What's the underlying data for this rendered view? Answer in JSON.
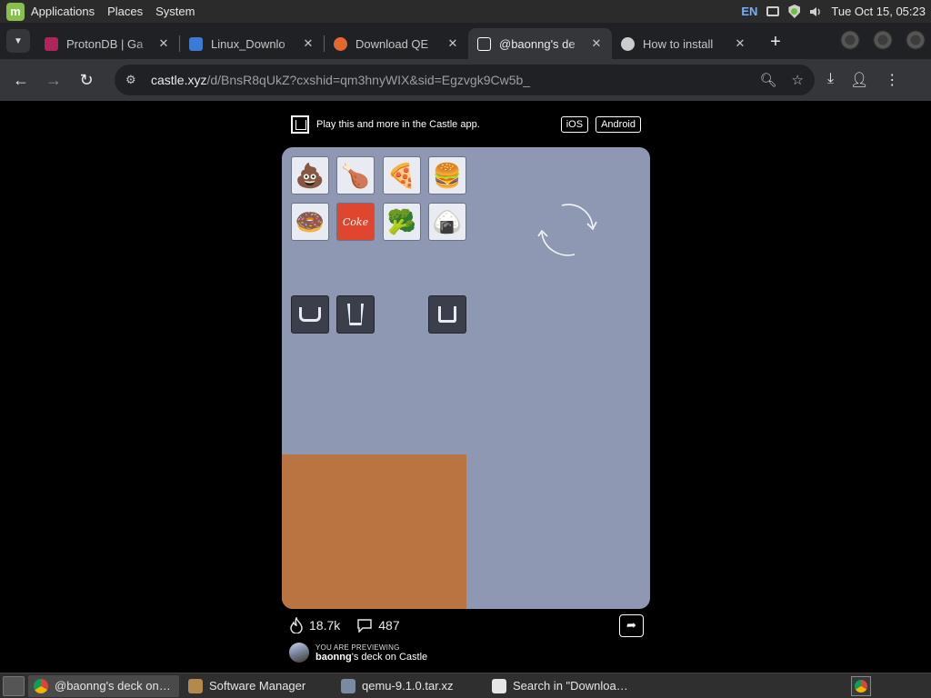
{
  "system_panel": {
    "menu": [
      "Applications",
      "Places",
      "System"
    ],
    "keyboard_layout": "EN",
    "clock": "Tue Oct 15, 05:23"
  },
  "tabs": [
    {
      "title": "ProtonDB | Ga",
      "favicon_color": "#b0245b",
      "active": false
    },
    {
      "title": "Linux_Downlo",
      "favicon_color": "#3a7bd5",
      "active": false
    },
    {
      "title": "Download QE",
      "favicon_color": "#e5672e",
      "active": false
    },
    {
      "title": "@baonng's de",
      "favicon_color": "#ffffff",
      "active": true
    },
    {
      "title": "How to install",
      "favicon_color": "#cccccc",
      "active": false
    }
  ],
  "address_bar": {
    "domain": "castle.xyz",
    "path": "/d/BnsR8qUkZ?cxshid=qm3hnyWIX&sid=Egzvgk9Cw5b_"
  },
  "castle": {
    "banner_text": "Play this and more in the Castle app.",
    "ios_label": "iOS",
    "android_label": "Android",
    "tiles_row1": [
      "💩",
      "🍗",
      "🍕",
      "🍔"
    ],
    "tiles_row2": [
      "🍩",
      "Coke",
      "🥦",
      "🍙"
    ],
    "likes": "18.7k",
    "comments": "487",
    "preview_kicker": "YOU ARE PREVIEWING",
    "preview_user": "baonng",
    "preview_suffix": "'s deck on Castle",
    "colors": {
      "deck_bg": "#8e98b3",
      "orange_block": "#b97442",
      "coke_tile": "#e0462e"
    }
  },
  "taskbar": {
    "items": [
      {
        "label": "@baonng's deck on…",
        "active": true
      },
      {
        "label": "Software Manager",
        "active": false
      },
      {
        "label": "qemu-9.1.0.tar.xz",
        "active": false
      },
      {
        "label": "Search in \"Downloa…",
        "active": false
      }
    ]
  }
}
